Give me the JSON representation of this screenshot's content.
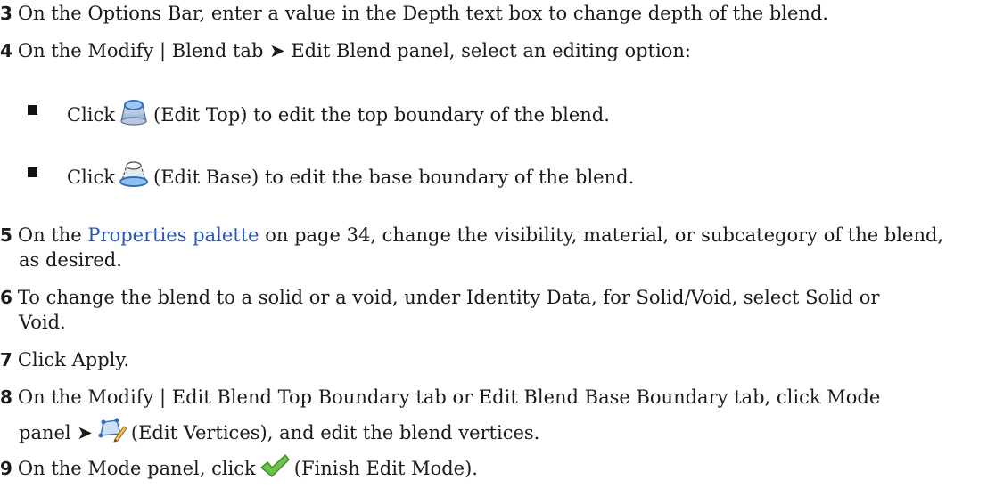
{
  "steps": [
    {
      "number": "3",
      "text": "On the Options Bar, enter a value in the Depth text box to change depth of the blend."
    },
    {
      "number": "4",
      "text": "On the Modify | Blend tab ➤ Edit Blend panel, select an editing option:"
    },
    {
      "number": "5",
      "link": "Properties palette",
      "text": " on page 34, change the visibility, material, or subcategory of the blend,",
      "text2": "as desired.",
      "prefix": "On the "
    },
    {
      "number": "6",
      "text": "To change the blend to a solid or a void, under Identity Data, for Solid/Void, select Solid or",
      "text2": "Void."
    },
    {
      "number": "7",
      "text": "Click Apply."
    },
    {
      "number": "8",
      "text": "On the Modify | Edit Blend Top Boundary tab or Edit Blend Base Boundary tab, click Mode",
      "text2a": "panel ➤",
      "text2b": "(Edit Vertices), and edit the blend vertices."
    },
    {
      "number": "9",
      "texta": "On the Mode panel, click",
      "textb": "(Finish Edit Mode)."
    }
  ],
  "bullets": [
    {
      "pre": "Click",
      "post": "(Edit Top) to edit the top boundary of the blend.",
      "icon": "edit-top-icon"
    },
    {
      "pre": "Click",
      "post": "(Edit Base) to edit the base boundary of the blend.",
      "icon": "edit-base-icon"
    }
  ]
}
